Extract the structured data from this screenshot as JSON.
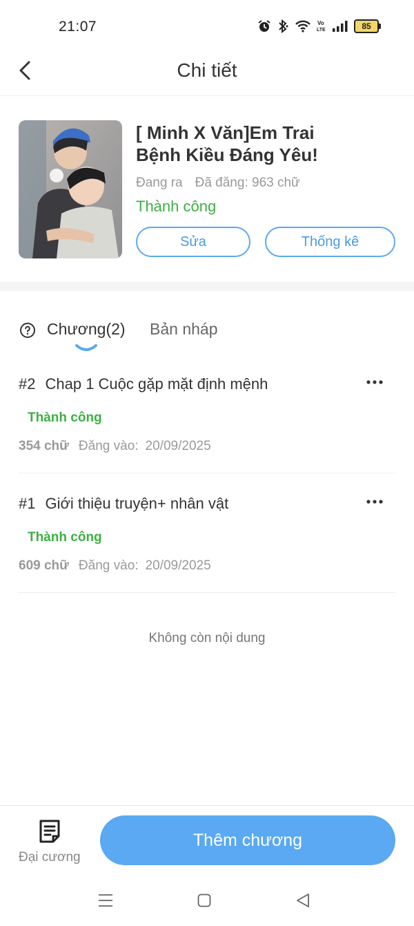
{
  "status_bar": {
    "time": "21:07",
    "battery": "85",
    "icons": [
      "alarm-icon",
      "bluetooth-icon",
      "wifi-icon",
      "volte-icon",
      "signal-icon",
      "battery-icon"
    ]
  },
  "header": {
    "title": "Chi tiết"
  },
  "book": {
    "title": "[ Minh X Văn]Em Trai Bệnh Kiều Đáng Yêu!",
    "state": "Đang ra",
    "words": "Đã đăng: 963 chữ",
    "status": "Thành  công",
    "edit_label": "Sửa",
    "stats_label": "Thống kê"
  },
  "tabs": {
    "chapters": "Chương(2)",
    "drafts": "Bản nháp"
  },
  "chapters": [
    {
      "num": "#2",
      "title": "Chap 1 Cuộc gặp mặt định mệnh",
      "status": "Thành công",
      "words": "354 chữ",
      "posted_label": "Đăng vào:",
      "date": "20/09/2025"
    },
    {
      "num": "#1",
      "title": "Giới thiệu truyện+ nhân vật",
      "status": "Thành công",
      "words": "609 chữ",
      "posted_label": "Đăng vào:",
      "date": "20/09/2025"
    }
  ],
  "no_more": "Không còn nội dung",
  "bottom": {
    "outline_label": "Đại cương",
    "add_chapter_label": "Thêm chương"
  },
  "colors": {
    "accent": "#5aa9f2",
    "success": "#3cb043",
    "battery_fill": "#f2d56b"
  }
}
